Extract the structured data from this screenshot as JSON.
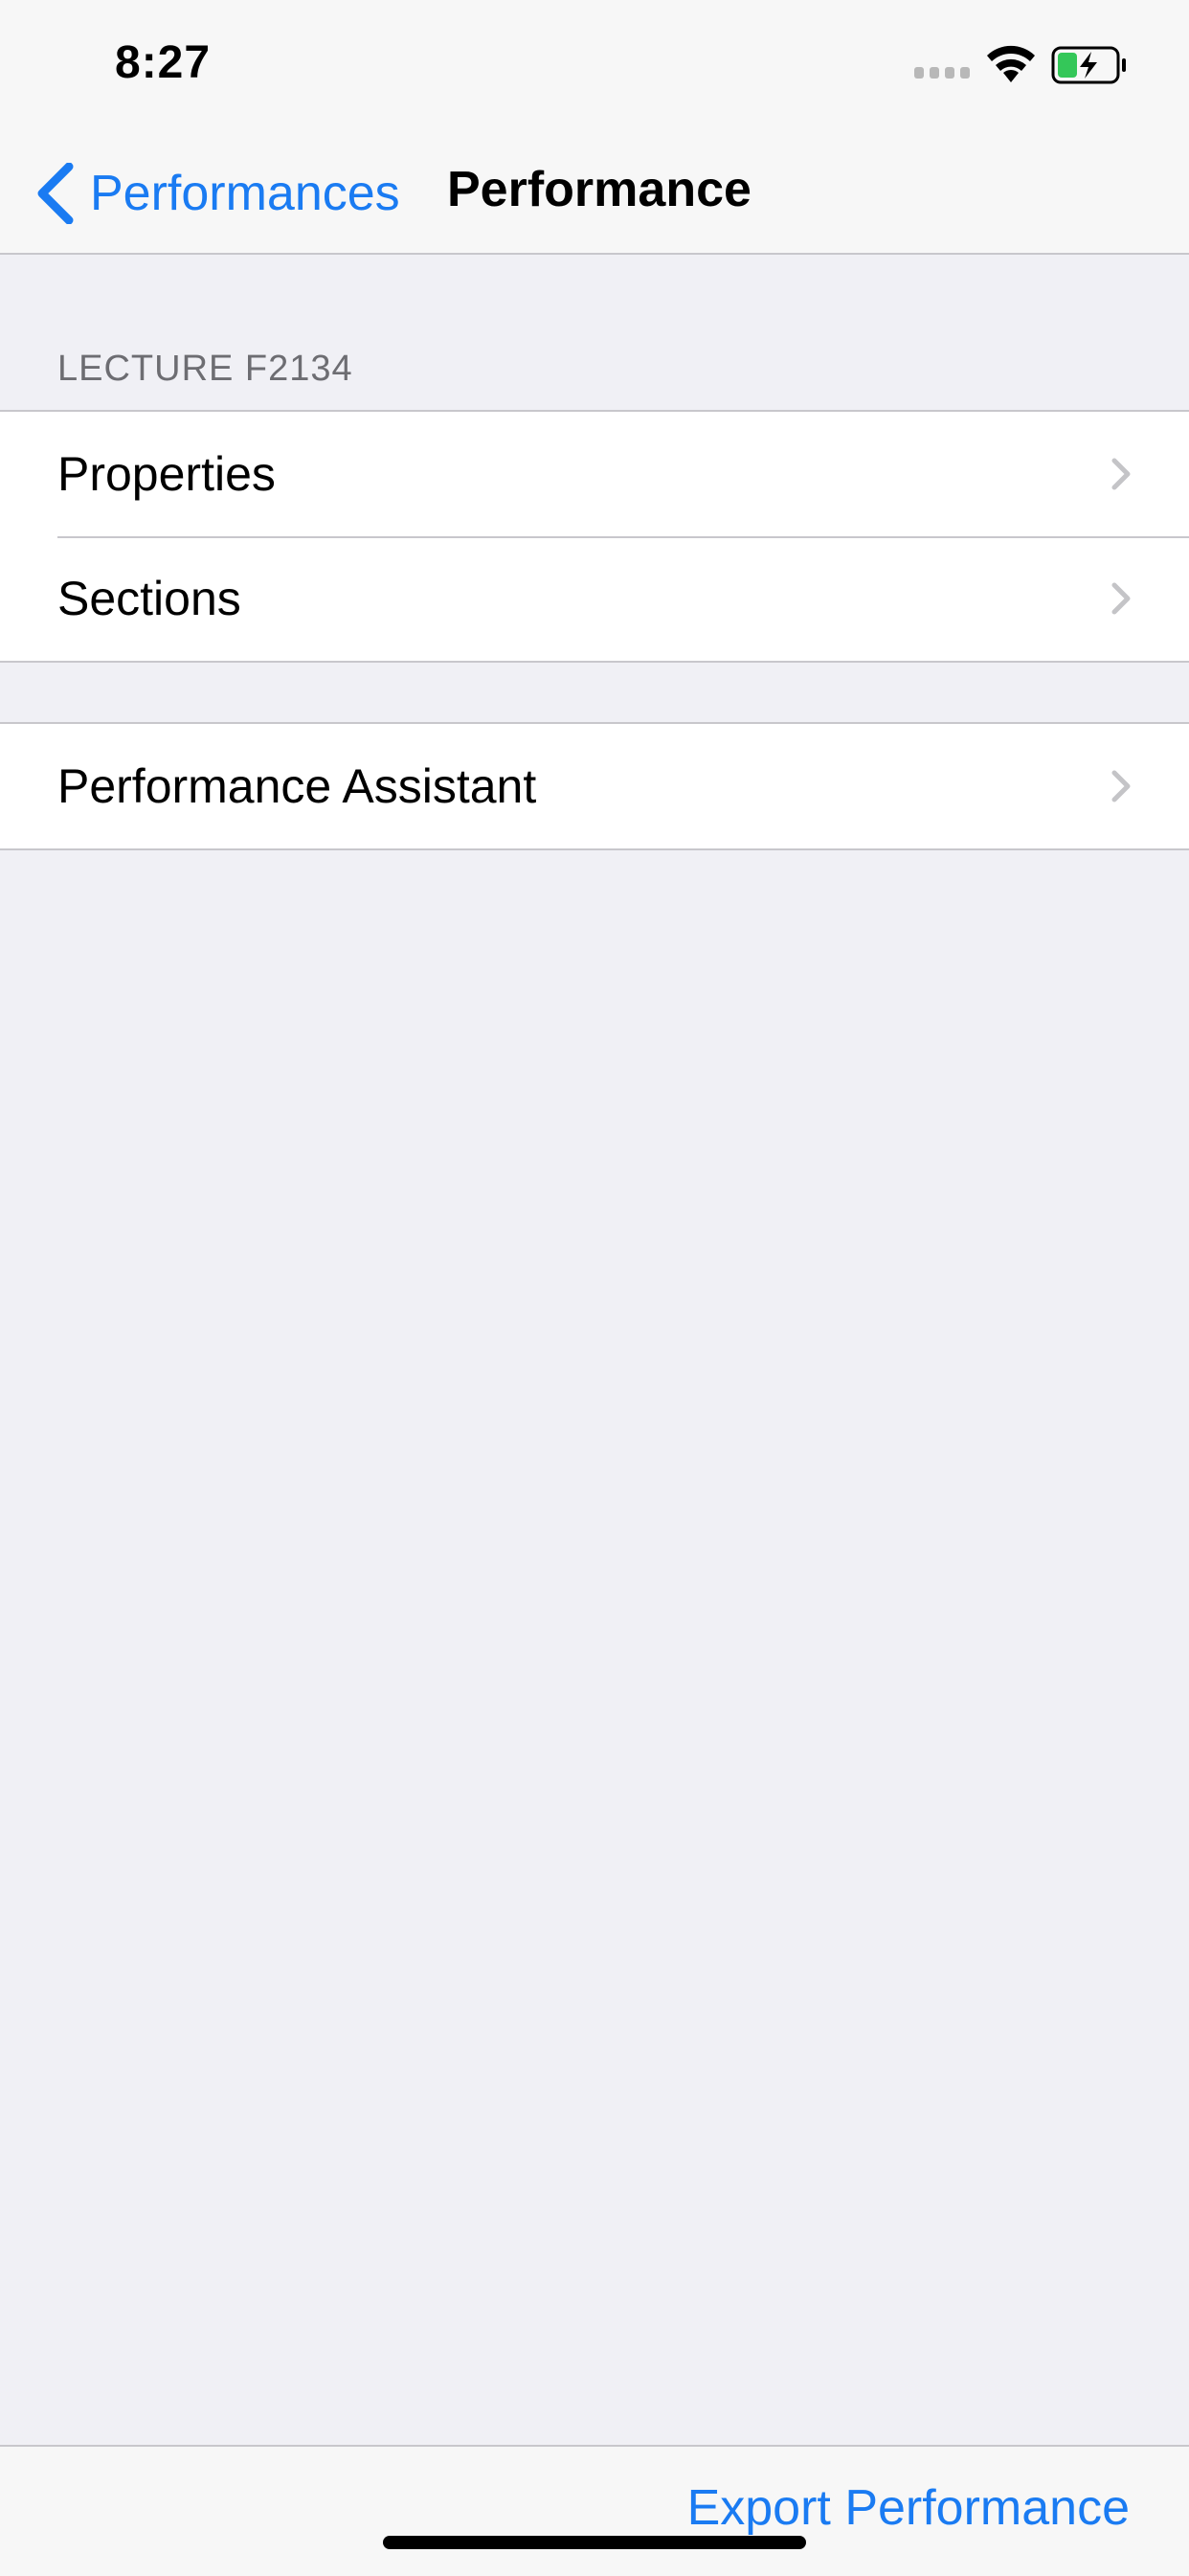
{
  "status_bar": {
    "time": "8:27",
    "icons": [
      "cellular-signal-icon",
      "wifi-icon",
      "battery-charging-icon"
    ]
  },
  "nav_bar": {
    "back_label": "Performances",
    "title": "Performance"
  },
  "section": {
    "header": "LECTURE F2134",
    "items": [
      {
        "label": "Properties"
      },
      {
        "label": "Sections"
      }
    ]
  },
  "assistant": {
    "label": "Performance Assistant"
  },
  "toolbar": {
    "export_label": "Export Performance"
  },
  "colors": {
    "accent": "#1a7bf2",
    "background": "#f0f0f5",
    "battery_fill": "#34c759"
  }
}
